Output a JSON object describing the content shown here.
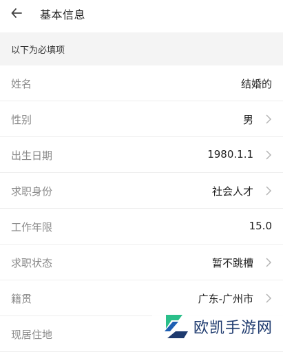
{
  "header": {
    "title": "基本信息",
    "back_icon": "back-arrow-icon"
  },
  "notice": {
    "text": "以下为必填项"
  },
  "fields": [
    {
      "label": "姓名",
      "value": "结婚的",
      "arrow": false
    },
    {
      "label": "性别",
      "value": "男",
      "arrow": true
    },
    {
      "label": "出生日期",
      "value": "1980.1.1",
      "arrow": true
    },
    {
      "label": "求职身份",
      "value": "社会人才",
      "arrow": true
    },
    {
      "label": "工作年限",
      "value": "15.0",
      "arrow": false
    },
    {
      "label": "求职状态",
      "value": "暂不跳槽",
      "arrow": true
    },
    {
      "label": "籍贯",
      "value": "广东-广州市",
      "arrow": true
    },
    {
      "label": "现居住地",
      "value": "",
      "arrow": false
    }
  ],
  "watermark": {
    "text": "欧凯手游网"
  },
  "colors": {
    "label": "#8a8a8a",
    "value": "#222222",
    "notice_bg": "#f4f4f4",
    "divider": "#eeeeee"
  }
}
